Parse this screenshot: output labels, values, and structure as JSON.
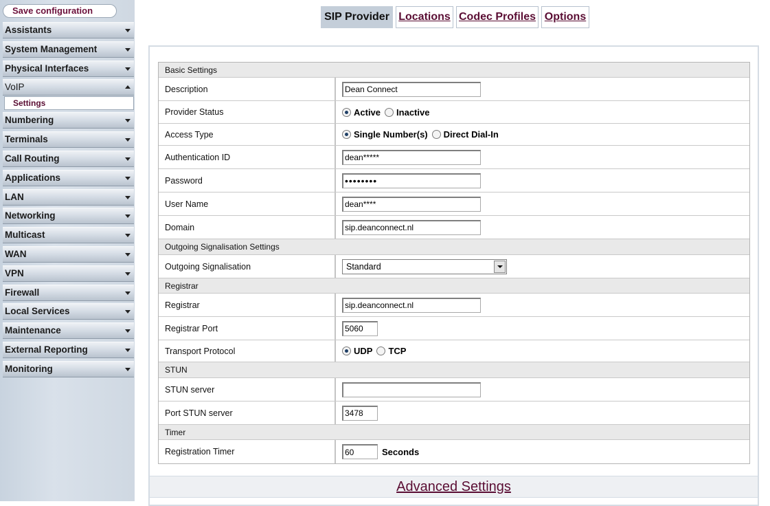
{
  "sidebar": {
    "save_label": "Save configuration",
    "items": [
      {
        "label": "Assistants",
        "expanded": false
      },
      {
        "label": "System Management",
        "expanded": false
      },
      {
        "label": "Physical Interfaces",
        "expanded": false
      },
      {
        "label": "VoIP",
        "expanded": true
      },
      {
        "label": "Numbering",
        "expanded": false
      },
      {
        "label": "Terminals",
        "expanded": false
      },
      {
        "label": "Call Routing",
        "expanded": false
      },
      {
        "label": "Applications",
        "expanded": false
      },
      {
        "label": "LAN",
        "expanded": false
      },
      {
        "label": "Networking",
        "expanded": false
      },
      {
        "label": "Multicast",
        "expanded": false
      },
      {
        "label": "WAN",
        "expanded": false
      },
      {
        "label": "VPN",
        "expanded": false
      },
      {
        "label": "Firewall",
        "expanded": false
      },
      {
        "label": "Local Services",
        "expanded": false
      },
      {
        "label": "Maintenance",
        "expanded": false
      },
      {
        "label": "External Reporting",
        "expanded": false
      },
      {
        "label": "Monitoring",
        "expanded": false
      }
    ],
    "voip_sub": "Settings"
  },
  "tabs": [
    {
      "label": "SIP Provider",
      "active": true
    },
    {
      "label": "Locations",
      "active": false
    },
    {
      "label": "Codec Profiles",
      "active": false
    },
    {
      "label": "Options",
      "active": false
    }
  ],
  "form": {
    "basic": {
      "title": "Basic Settings",
      "description_label": "Description",
      "description_value": "Dean Connect",
      "provider_status_label": "Provider Status",
      "status_active": "Active",
      "status_inactive": "Inactive",
      "access_type_label": "Access Type",
      "access_single": "Single Number(s)",
      "access_ddi": "Direct Dial-In",
      "auth_id_label": "Authentication ID",
      "auth_id_value": "dean*****",
      "password_label": "Password",
      "password_value": "••••••••",
      "username_label": "User Name",
      "username_value": "dean****",
      "domain_label": "Domain",
      "domain_value": "sip.deanconnect.nl"
    },
    "outgoing": {
      "title": "Outgoing Signalisation Settings",
      "label": "Outgoing Signalisation",
      "value": "Standard"
    },
    "registrar": {
      "title": "Registrar",
      "registrar_label": "Registrar",
      "registrar_value": "sip.deanconnect.nl",
      "port_label": "Registrar Port",
      "port_value": "5060",
      "transport_label": "Transport Protocol",
      "udp": "UDP",
      "tcp": "TCP"
    },
    "stun": {
      "title": "STUN",
      "server_label": "STUN server",
      "server_value": "",
      "port_label": "Port STUN server",
      "port_value": "3478"
    },
    "timer": {
      "title": "Timer",
      "label": "Registration Timer",
      "value": "60",
      "unit": "Seconds"
    }
  },
  "advanced_label": "Advanced Settings"
}
